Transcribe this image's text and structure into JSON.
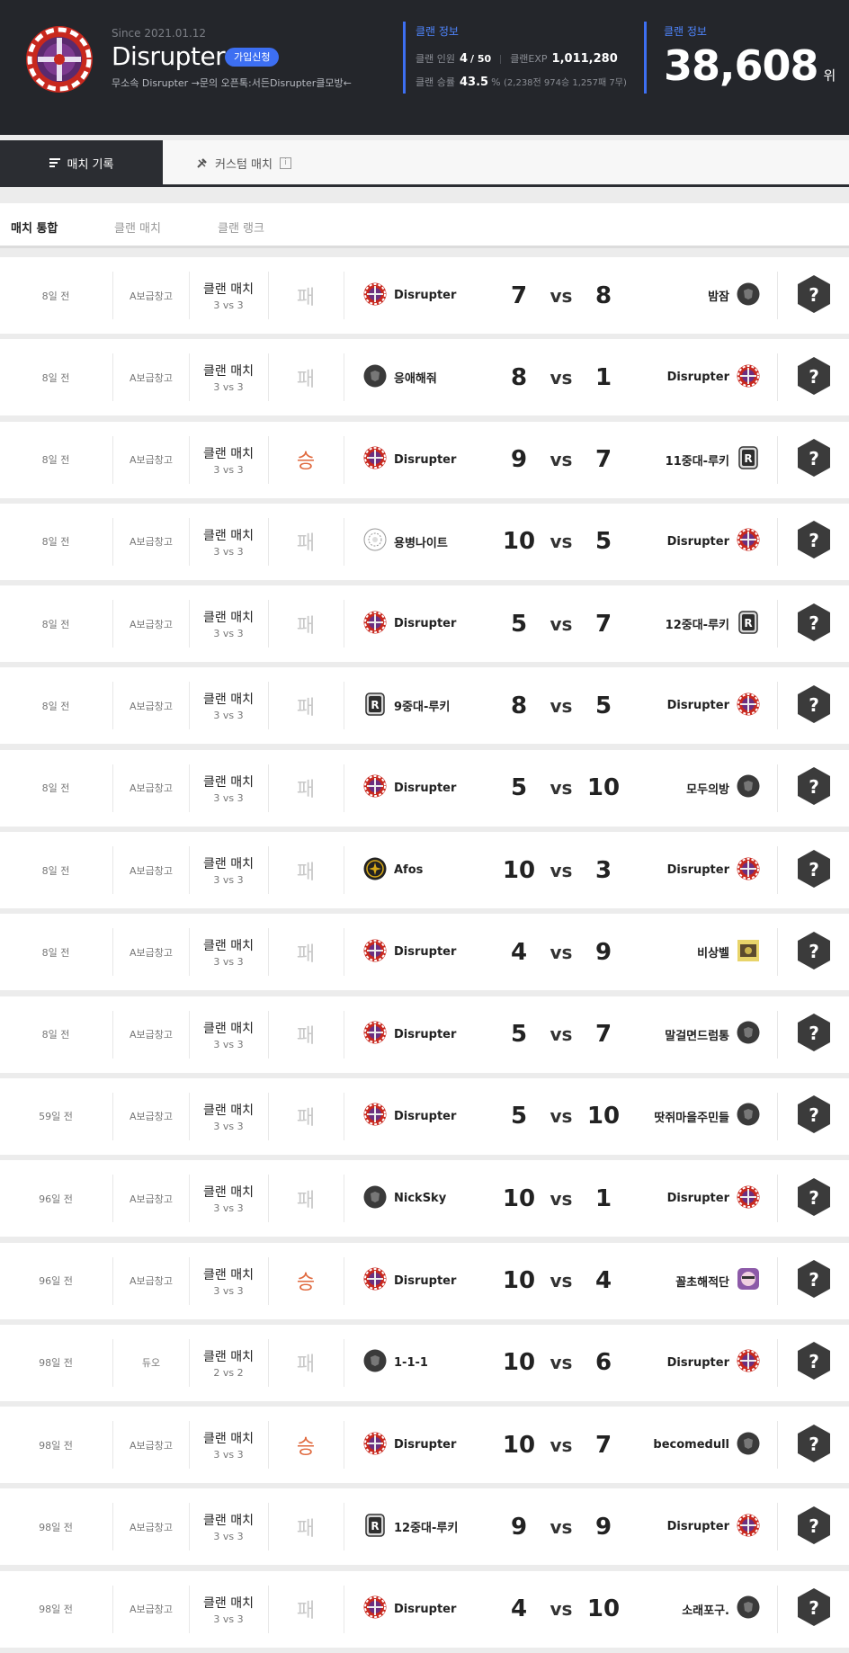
{
  "clan": {
    "since": "Since 2021.01.12",
    "name": "Disrupter",
    "join_label": "가입신청",
    "description": "무소속 Disrupter →문의 오픈톡:서든Disrupter클모방←"
  },
  "clan_info": {
    "heading": "클랜 정보",
    "members_label": "클랜 인원",
    "members_value": "4",
    "members_max": "/ 50",
    "exp_label": "클랜EXP",
    "exp_value": "1,011,280",
    "winrate_label": "클랜 승률",
    "winrate_value": "43.5",
    "winrate_unit": "%",
    "winrate_detail": "(2,238전 974승 1,257패 7무)"
  },
  "ranking": {
    "heading": "클랜 정보",
    "value": "38,608",
    "unit": "위"
  },
  "tabs": [
    {
      "label": "매치 기록",
      "icon": "list-icon"
    },
    {
      "label": "커스텀 매치",
      "icon": "tools-icon",
      "info": "i"
    }
  ],
  "subtabs": [
    "매치 통합",
    "클랜 매치",
    "클랜 랭크"
  ],
  "colors": {
    "accent": "#3d6ff2",
    "win": "#e06a3f",
    "lose": "#c8c8c8",
    "header_bg": "#24262b"
  },
  "vs_label": "vs",
  "detail_icon": "?",
  "matches": [
    {
      "time": "8일 전",
      "map": "A보급창고",
      "mode": "클랜 매치",
      "size": "3 vs 3",
      "result": "패",
      "outcome": "lose",
      "left_team": "Disrupter",
      "left_logo": "disrupter",
      "left_score": "7",
      "right_score": "8",
      "right_team": "밤잠",
      "right_logo": "dark"
    },
    {
      "time": "8일 전",
      "map": "A보급창고",
      "mode": "클랜 매치",
      "size": "3 vs 3",
      "result": "패",
      "outcome": "lose",
      "left_team": "응애해줘",
      "left_logo": "dark",
      "left_score": "8",
      "right_score": "1",
      "right_team": "Disrupter",
      "right_logo": "disrupter"
    },
    {
      "time": "8일 전",
      "map": "A보급창고",
      "mode": "클랜 매치",
      "size": "3 vs 3",
      "result": "승",
      "outcome": "win",
      "left_team": "Disrupter",
      "left_logo": "disrupter",
      "left_score": "9",
      "right_score": "7",
      "right_team": "11중대-루키",
      "right_logo": "r"
    },
    {
      "time": "8일 전",
      "map": "A보급창고",
      "mode": "클랜 매치",
      "size": "3 vs 3",
      "result": "패",
      "outcome": "lose",
      "left_team": "용병나이트",
      "left_logo": "flower",
      "left_score": "10",
      "right_score": "5",
      "right_team": "Disrupter",
      "right_logo": "disrupter"
    },
    {
      "time": "8일 전",
      "map": "A보급창고",
      "mode": "클랜 매치",
      "size": "3 vs 3",
      "result": "패",
      "outcome": "lose",
      "left_team": "Disrupter",
      "left_logo": "disrupter",
      "left_score": "5",
      "right_score": "7",
      "right_team": "12중대-루키",
      "right_logo": "r"
    },
    {
      "time": "8일 전",
      "map": "A보급창고",
      "mode": "클랜 매치",
      "size": "3 vs 3",
      "result": "패",
      "outcome": "lose",
      "left_team": "9중대-루키",
      "left_logo": "r",
      "left_score": "8",
      "right_score": "5",
      "right_team": "Disrupter",
      "right_logo": "disrupter"
    },
    {
      "time": "8일 전",
      "map": "A보급창고",
      "mode": "클랜 매치",
      "size": "3 vs 3",
      "result": "패",
      "outcome": "lose",
      "left_team": "Disrupter",
      "left_logo": "disrupter",
      "left_score": "5",
      "right_score": "10",
      "right_team": "모두의방",
      "right_logo": "dark"
    },
    {
      "time": "8일 전",
      "map": "A보급창고",
      "mode": "클랜 매치",
      "size": "3 vs 3",
      "result": "패",
      "outcome": "lose",
      "left_team": "Afos",
      "left_logo": "gold",
      "left_score": "10",
      "right_score": "3",
      "right_team": "Disrupter",
      "right_logo": "disrupter"
    },
    {
      "time": "8일 전",
      "map": "A보급창고",
      "mode": "클랜 매치",
      "size": "3 vs 3",
      "result": "패",
      "outcome": "lose",
      "left_team": "Disrupter",
      "left_logo": "disrupter",
      "left_score": "4",
      "right_score": "9",
      "right_team": "비상벨",
      "right_logo": "yellow"
    },
    {
      "time": "8일 전",
      "map": "A보급창고",
      "mode": "클랜 매치",
      "size": "3 vs 3",
      "result": "패",
      "outcome": "lose",
      "left_team": "Disrupter",
      "left_logo": "disrupter",
      "left_score": "5",
      "right_score": "7",
      "right_team": "말걸면드럼통",
      "right_logo": "dark"
    },
    {
      "time": "59일 전",
      "map": "A보급창고",
      "mode": "클랜 매치",
      "size": "3 vs 3",
      "result": "패",
      "outcome": "lose",
      "left_team": "Disrupter",
      "left_logo": "disrupter",
      "left_score": "5",
      "right_score": "10",
      "right_team": "땃쥐마을주민들",
      "right_logo": "dark"
    },
    {
      "time": "96일 전",
      "map": "A보급창고",
      "mode": "클랜 매치",
      "size": "3 vs 3",
      "result": "패",
      "outcome": "lose",
      "left_team": "NickSky",
      "left_logo": "dark",
      "left_score": "10",
      "right_score": "1",
      "right_team": "Disrupter",
      "right_logo": "disrupter"
    },
    {
      "time": "96일 전",
      "map": "A보급창고",
      "mode": "클랜 매치",
      "size": "3 vs 3",
      "result": "승",
      "outcome": "win",
      "left_team": "Disrupter",
      "left_logo": "disrupter",
      "left_score": "10",
      "right_score": "4",
      "right_team": "꼴초해적단",
      "right_logo": "pirate"
    },
    {
      "time": "98일 전",
      "map": "듀오",
      "mode": "클랜 매치",
      "size": "2 vs 2",
      "result": "패",
      "outcome": "lose",
      "left_team": "1-1-1",
      "left_logo": "dark",
      "left_score": "10",
      "right_score": "6",
      "right_team": "Disrupter",
      "right_logo": "disrupter"
    },
    {
      "time": "98일 전",
      "map": "A보급창고",
      "mode": "클랜 매치",
      "size": "3 vs 3",
      "result": "승",
      "outcome": "win",
      "left_team": "Disrupter",
      "left_logo": "disrupter",
      "left_score": "10",
      "right_score": "7",
      "right_team": "becomedull",
      "right_logo": "dark"
    },
    {
      "time": "98일 전",
      "map": "A보급창고",
      "mode": "클랜 매치",
      "size": "3 vs 3",
      "result": "패",
      "outcome": "lose",
      "left_team": "12중대-루키",
      "left_logo": "r",
      "left_score": "9",
      "right_score": "9",
      "right_team": "Disrupter",
      "right_logo": "disrupter"
    },
    {
      "time": "98일 전",
      "map": "A보급창고",
      "mode": "클랜 매치",
      "size": "3 vs 3",
      "result": "패",
      "outcome": "lose",
      "left_team": "Disrupter",
      "left_logo": "disrupter",
      "left_score": "4",
      "right_score": "10",
      "right_team": "소래포구.",
      "right_logo": "dark"
    }
  ]
}
